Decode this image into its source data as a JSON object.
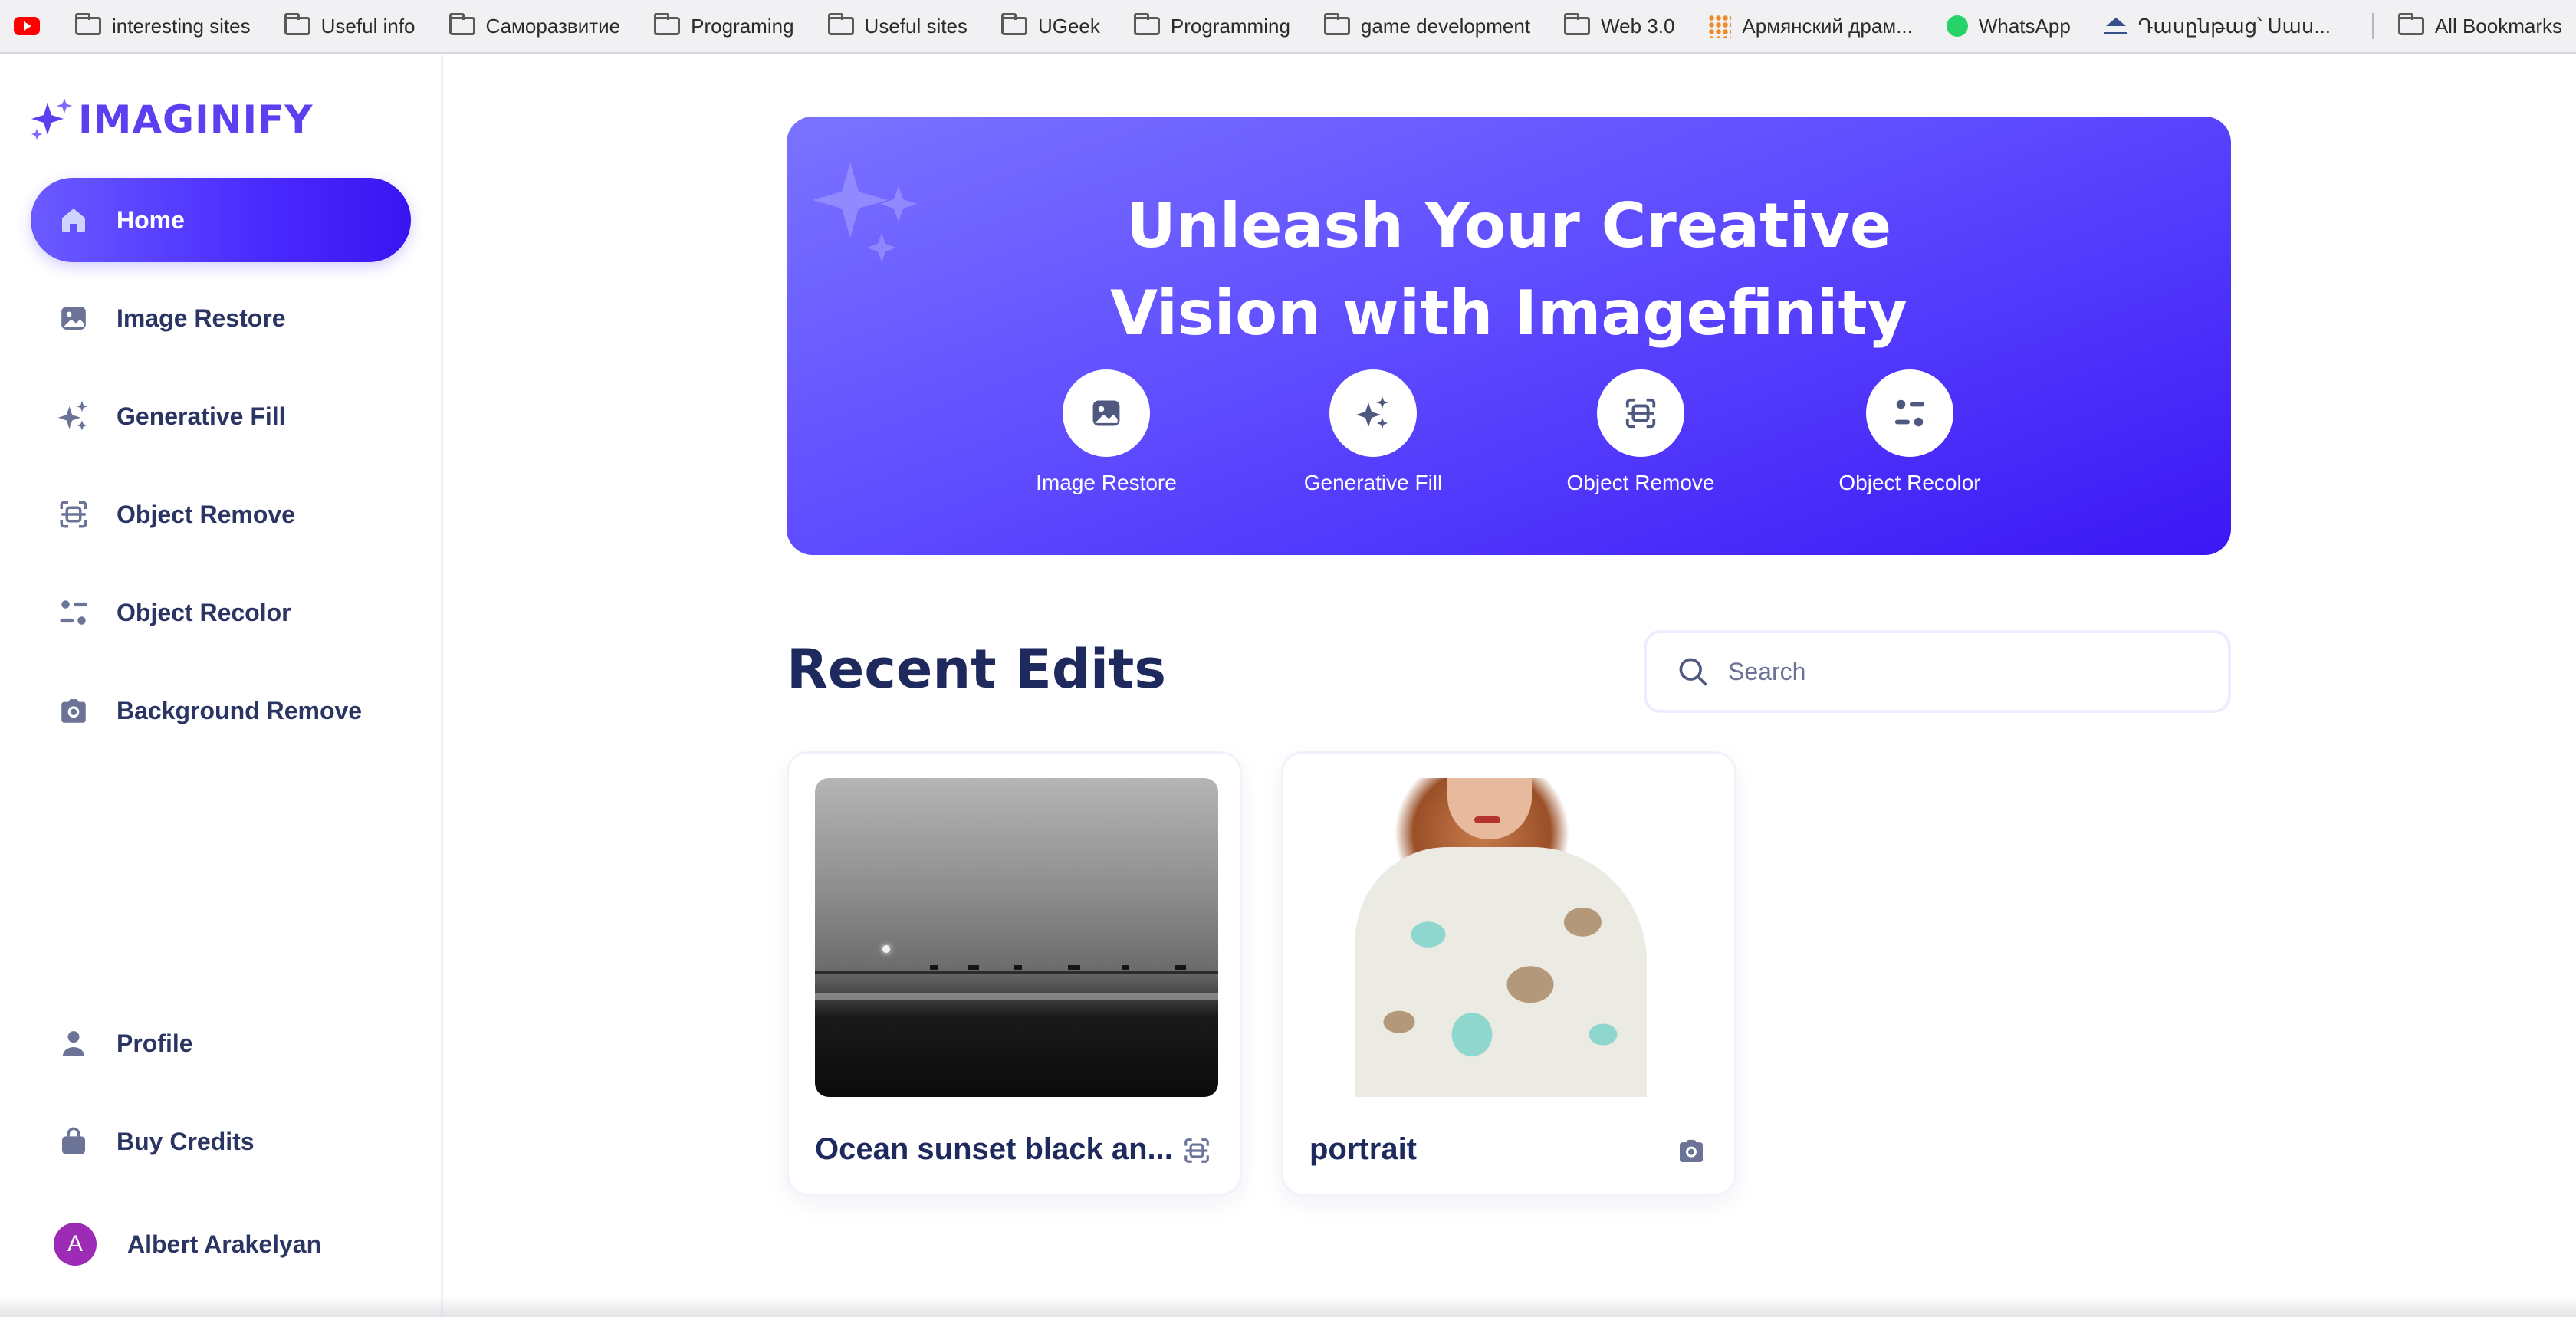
{
  "bookmarks": [
    {
      "label": "",
      "icon": "youtube-icon"
    },
    {
      "label": "interesting sites",
      "icon": "folder-icon"
    },
    {
      "label": "Useful info",
      "icon": "folder-icon"
    },
    {
      "label": "Саморазвитие",
      "icon": "folder-icon"
    },
    {
      "label": "Programing",
      "icon": "folder-icon"
    },
    {
      "label": "Useful sites",
      "icon": "folder-icon"
    },
    {
      "label": "UGeek",
      "icon": "folder-icon"
    },
    {
      "label": "Programming",
      "icon": "folder-icon"
    },
    {
      "label": "game development",
      "icon": "folder-icon"
    },
    {
      "label": "Web 3.0",
      "icon": "folder-icon"
    },
    {
      "label": "Армянский драм...",
      "icon": "grid-icon"
    },
    {
      "label": "WhatsApp",
      "icon": "whatsapp-icon"
    },
    {
      "label": "Դասընթաց՝ Սաս...",
      "icon": "graduation-cap-icon"
    }
  ],
  "bookmarks_all": {
    "label": "All Bookmarks",
    "icon": "folder-icon"
  },
  "brand": {
    "name": "IMAGINIFY",
    "accent": "#5b3ff0"
  },
  "sidebar": {
    "items": [
      {
        "label": "Home",
        "icon": "home-icon",
        "active": true
      },
      {
        "label": "Image Restore",
        "icon": "image-icon"
      },
      {
        "label": "Generative Fill",
        "icon": "sparkles-icon"
      },
      {
        "label": "Object Remove",
        "icon": "scan-icon"
      },
      {
        "label": "Object Recolor",
        "icon": "filter-icon"
      },
      {
        "label": "Background Remove",
        "icon": "camera-icon"
      }
    ],
    "bottom_items": [
      {
        "label": "Profile",
        "icon": "user-icon"
      },
      {
        "label": "Buy Credits",
        "icon": "bag-icon"
      }
    ],
    "user": {
      "initial": "A",
      "name": "Albert Arakelyan",
      "avatar_color": "#9d2bb6"
    }
  },
  "hero": {
    "title_line1": "Unleash Your Creative",
    "title_line2": "Vision with Imagefinity",
    "tools": [
      {
        "label": "Image Restore",
        "icon": "image-icon"
      },
      {
        "label": "Generative Fill",
        "icon": "sparkles-icon"
      },
      {
        "label": "Object Remove",
        "icon": "scan-icon"
      },
      {
        "label": "Object Recolor",
        "icon": "filter-icon"
      }
    ]
  },
  "recent": {
    "title": "Recent Edits",
    "search_placeholder": "Search",
    "cards": [
      {
        "title": "Ocean sunset black an...",
        "icon": "scan-icon"
      },
      {
        "title": "portrait",
        "icon": "camera-icon"
      }
    ]
  }
}
